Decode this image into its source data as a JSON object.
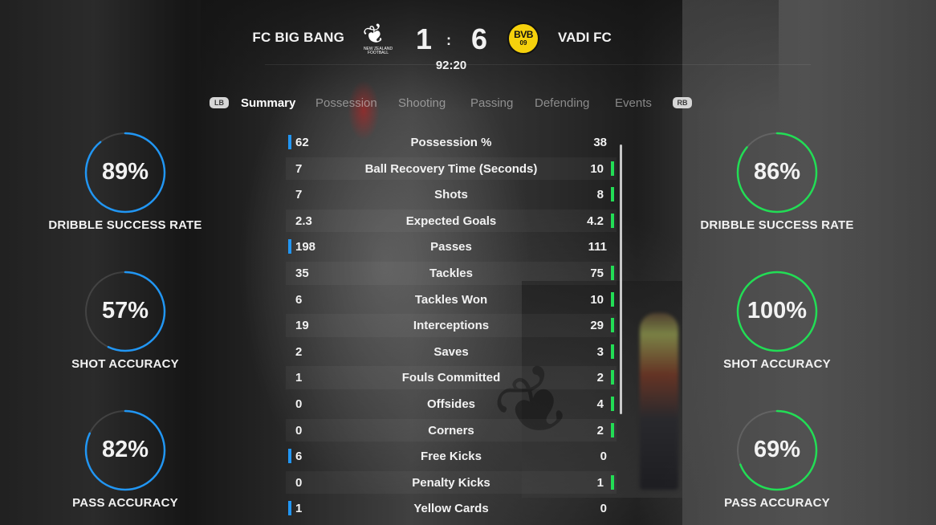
{
  "match": {
    "home_team": "FC BIG BANG",
    "away_team": "VADI FC",
    "home_score": "1",
    "separator": ":",
    "away_score": "6",
    "clock": "92:20",
    "home_crest": {
      "icon": "new-zealand-football-crest-icon",
      "text": "NEW ZEALAND FOOTBALL"
    },
    "away_crest": {
      "icon": "bvb-crest-icon",
      "top": "BVB",
      "bottom": "09"
    }
  },
  "tabs": {
    "left_button": "LB",
    "right_button": "RB",
    "items": [
      "Summary",
      "Possession",
      "Shooting",
      "Passing",
      "Defending",
      "Events"
    ],
    "active": "Summary"
  },
  "colors": {
    "home": "#2196f3",
    "away": "#22dd55"
  },
  "stats": [
    {
      "label": "Possession %",
      "home": "62",
      "away": "38",
      "lead": "home"
    },
    {
      "label": "Ball Recovery Time (Seconds)",
      "home": "7",
      "away": "10",
      "lead": "away"
    },
    {
      "label": "Shots",
      "home": "7",
      "away": "8",
      "lead": "away"
    },
    {
      "label": "Expected Goals",
      "home": "2.3",
      "away": "4.2",
      "lead": "away"
    },
    {
      "label": "Passes",
      "home": "198",
      "away": "111",
      "lead": "home"
    },
    {
      "label": "Tackles",
      "home": "35",
      "away": "75",
      "lead": "away"
    },
    {
      "label": "Tackles Won",
      "home": "6",
      "away": "10",
      "lead": "away"
    },
    {
      "label": "Interceptions",
      "home": "19",
      "away": "29",
      "lead": "away"
    },
    {
      "label": "Saves",
      "home": "2",
      "away": "3",
      "lead": "away"
    },
    {
      "label": "Fouls Committed",
      "home": "1",
      "away": "2",
      "lead": "away"
    },
    {
      "label": "Offsides",
      "home": "0",
      "away": "4",
      "lead": "away"
    },
    {
      "label": "Corners",
      "home": "0",
      "away": "2",
      "lead": "away"
    },
    {
      "label": "Free Kicks",
      "home": "6",
      "away": "0",
      "lead": "home"
    },
    {
      "label": "Penalty Kicks",
      "home": "0",
      "away": "1",
      "lead": "away"
    },
    {
      "label": "Yellow Cards",
      "home": "1",
      "away": "0",
      "lead": "home"
    }
  ],
  "home_gauges": [
    {
      "value": "89%",
      "fraction": 0.89,
      "caption": "DRIBBLE SUCCESS RATE"
    },
    {
      "value": "57%",
      "fraction": 0.57,
      "caption": "SHOT ACCURACY"
    },
    {
      "value": "82%",
      "fraction": 0.82,
      "caption": "PASS ACCURACY"
    }
  ],
  "away_gauges": [
    {
      "value": "86%",
      "fraction": 0.86,
      "caption": "DRIBBLE SUCCESS RATE"
    },
    {
      "value": "100%",
      "fraction": 1.0,
      "caption": "SHOT ACCURACY"
    },
    {
      "value": "69%",
      "fraction": 0.69,
      "caption": "PASS ACCURACY"
    }
  ]
}
